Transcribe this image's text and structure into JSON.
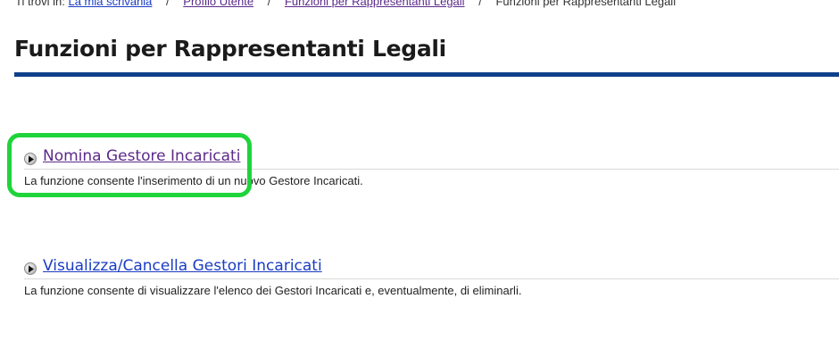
{
  "breadcrumb": {
    "prefix": "Ti trovi in:",
    "items": [
      {
        "label": "La mia scrivania",
        "link": true
      },
      {
        "label": "Profilo Utente",
        "link": true
      },
      {
        "label": "Funzioni per Rappresentanti Legali",
        "link": true
      },
      {
        "label": "Funzioni per Rappresentanti Legali",
        "link": false
      }
    ],
    "separator": "/"
  },
  "page": {
    "title": "Funzioni per Rappresentanti Legali"
  },
  "functions": [
    {
      "label": "Nomina Gestore Incaricati",
      "description": "La funzione consente l'inserimento di un nuovo Gestore Incaricati."
    },
    {
      "label": "Visualizza/Cancella Gestori Incaricati",
      "description": "La funzione consente di visualizzare l'elenco dei Gestori Incaricati e, eventualmente, di eliminarli."
    }
  ],
  "colors": {
    "title_rule": "#0e3f8a",
    "highlight": "#1fd43b",
    "link": "#1a3cc4",
    "visited_link": "#5b2a8a"
  },
  "icons": {
    "function_bullet": "play-icon"
  }
}
